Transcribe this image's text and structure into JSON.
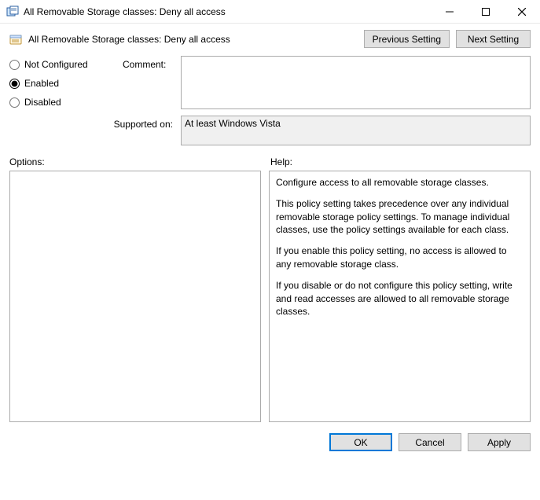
{
  "window": {
    "title": "All Removable Storage classes: Deny all access"
  },
  "header": {
    "policy_name": "All Removable Storage classes: Deny all access",
    "prev_label": "Previous Setting",
    "next_label": "Next Setting"
  },
  "state": {
    "not_configured_label": "Not Configured",
    "enabled_label": "Enabled",
    "disabled_label": "Disabled",
    "selected": "Enabled"
  },
  "fields": {
    "comment_label": "Comment:",
    "comment_value": "",
    "supported_label": "Supported on:",
    "supported_value": "At least Windows Vista"
  },
  "panes": {
    "options_label": "Options:",
    "help_label": "Help:"
  },
  "help": {
    "p1": "Configure access to all removable storage classes.",
    "p2": "This policy setting takes precedence over any individual removable storage policy settings. To manage individual classes, use the policy settings available for each class.",
    "p3": "If you enable this policy setting, no access is allowed to any removable storage class.",
    "p4": "If you disable or do not configure this policy setting, write and read accesses are allowed to all removable storage classes."
  },
  "buttons": {
    "ok": "OK",
    "cancel": "Cancel",
    "apply": "Apply"
  }
}
